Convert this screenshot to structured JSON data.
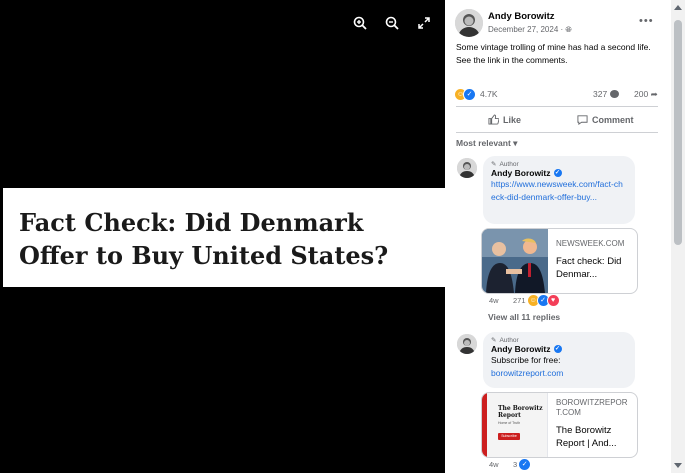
{
  "post": {
    "author": "Andy Borowitz",
    "date": "December 27, 2024 ·",
    "text": "Some vintage trolling of mine has had a second life. See the link in the comments.",
    "reaction_count": "4.7K",
    "comment_count": "327",
    "share_count": "200",
    "like_label": "Like",
    "comment_label": "Comment"
  },
  "image": {
    "headline": "Fact Check: Did Denmark Offer to Buy United States?"
  },
  "sort_label": "Most relevant",
  "comments": [
    {
      "badge": "Author",
      "name": "Andy Borowitz",
      "text": "",
      "link": "https://www.newsweek.com/fact-check-did-denmark-offer-buy...",
      "card_domain": "NEWSWEEK.COM",
      "card_title": "Fact check: Did Denmar...",
      "age": "4w",
      "reactions": "271",
      "replies": "View all 11 replies"
    },
    {
      "badge": "Author",
      "name": "Andy Borowitz",
      "text": "Subscribe for free:",
      "link": "borowitzreport.com",
      "card_domain": "BOROWITZREPORT.COM",
      "card_title": "The Borowitz Report | And...",
      "card_image_title": "The Borowitz Report",
      "card_image_sub": "Home of Truth",
      "card_image_button": "Subscribe",
      "age": "4w",
      "reactions": "3"
    }
  ],
  "colors": {
    "accent": "#1877f2",
    "link": "#216fdb",
    "brand_red": "#cc1f1f"
  }
}
